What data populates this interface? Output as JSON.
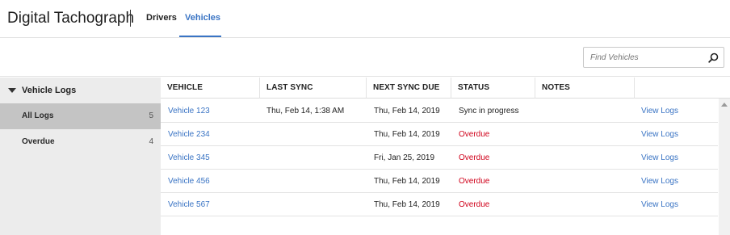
{
  "header": {
    "app_title": "Digital Tachograph",
    "tabs": [
      {
        "label": "Drivers",
        "active": false
      },
      {
        "label": "Vehicles",
        "active": true
      }
    ]
  },
  "toolbar": {
    "search_placeholder": "Find Vehicles",
    "search_icon": "search-icon"
  },
  "sidebar": {
    "title": "Vehicle Logs",
    "items": [
      {
        "label": "All Logs",
        "count": "5",
        "active": true
      },
      {
        "label": "Overdue",
        "count": "4",
        "active": false
      }
    ]
  },
  "table": {
    "columns": [
      "VEHICLE",
      "LAST SYNC",
      "NEXT SYNC DUE",
      "STATUS",
      "NOTES",
      ""
    ],
    "rows": [
      {
        "vehicle": "Vehicle 123",
        "last_sync": "Thu, Feb 14, 1:38 AM",
        "next_sync_due": "Thu, Feb 14, 2019",
        "status": "Sync in progress",
        "notes": "",
        "action": "View Logs"
      },
      {
        "vehicle": "Vehicle 234",
        "last_sync": "",
        "next_sync_due": "Thu, Feb 14, 2019",
        "status": "Overdue",
        "notes": "",
        "action": "View Logs"
      },
      {
        "vehicle": "Vehicle 345",
        "last_sync": "",
        "next_sync_due": "Fri, Jan 25, 2019",
        "status": "Overdue",
        "notes": "",
        "action": "View Logs"
      },
      {
        "vehicle": "Vehicle 456",
        "last_sync": "",
        "next_sync_due": "Thu, Feb 14, 2019",
        "status": "Overdue",
        "notes": "",
        "action": "View Logs"
      },
      {
        "vehicle": "Vehicle 567",
        "last_sync": "",
        "next_sync_due": "Thu, Feb 14, 2019",
        "status": "Overdue",
        "notes": "",
        "action": "View Logs"
      }
    ]
  },
  "colors": {
    "accent": "#3a74c4",
    "overdue": "#d0021b",
    "sidebar_bg": "#ececec",
    "sidebar_active": "#c4c4c4"
  }
}
